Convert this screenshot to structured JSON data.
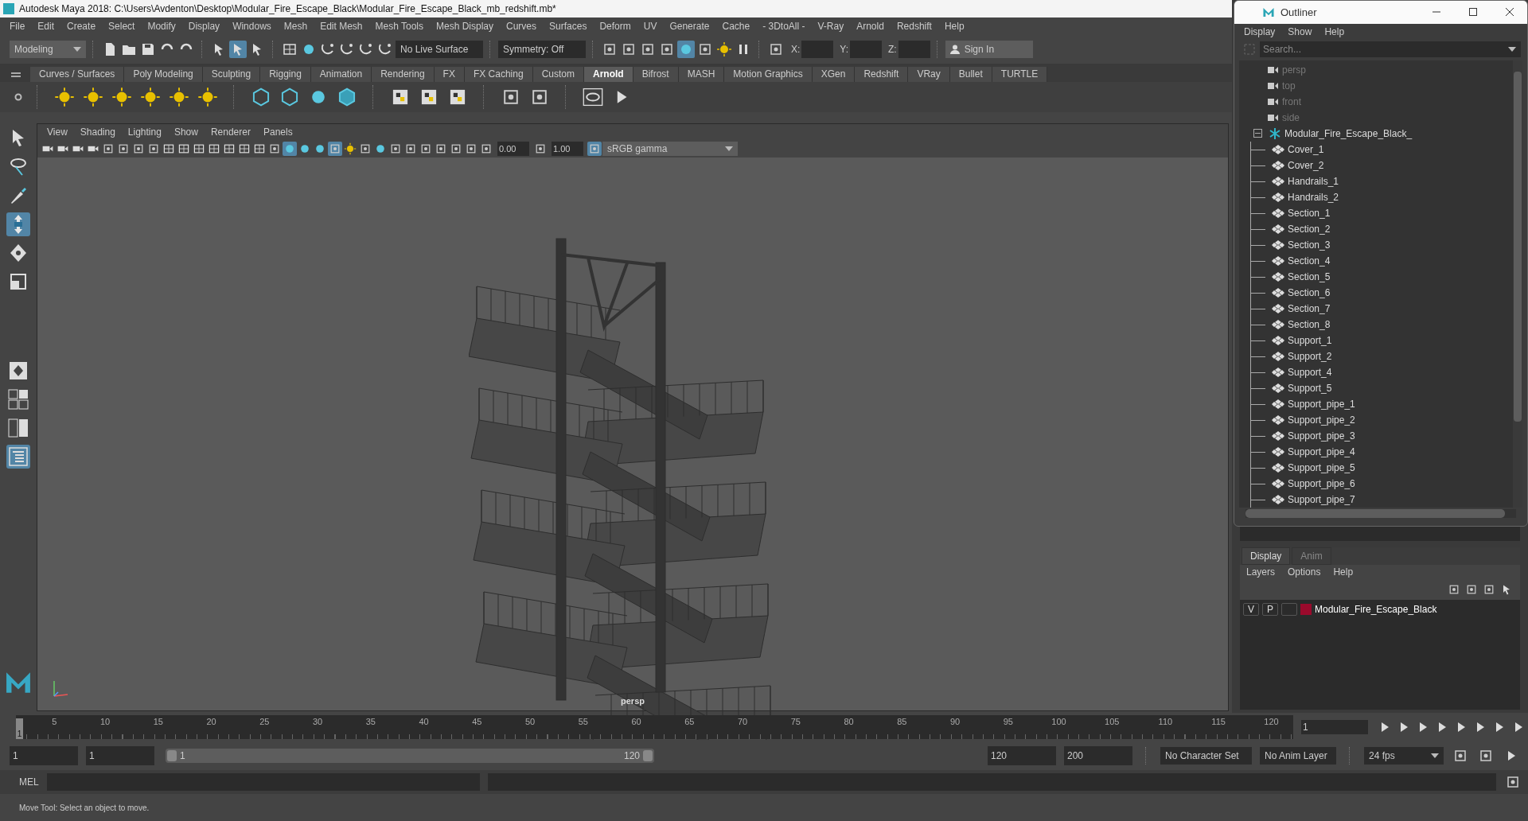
{
  "window": {
    "title": "Autodesk Maya 2018: C:\\Users\\Avdenton\\Desktop\\Modular_Fire_Escape_Black\\Modular_Fire_Escape_Black_mb_redshift.mb*"
  },
  "menu_bar": [
    "File",
    "Edit",
    "Create",
    "Select",
    "Modify",
    "Display",
    "Windows",
    "Mesh",
    "Edit Mesh",
    "Mesh Tools",
    "Mesh Display",
    "Curves",
    "Surfaces",
    "Deform",
    "UV",
    "Generate",
    "Cache",
    "- 3DtoAll -",
    "V-Ray",
    "Arnold",
    "Redshift",
    "Help"
  ],
  "status_line": {
    "mode": "Modeling",
    "live_surface": "No Live Surface",
    "symmetry": "Symmetry: Off",
    "x_label": "X:",
    "y_label": "Y:",
    "z_label": "Z:",
    "sign_in": "Sign In"
  },
  "shelf_tabs": [
    {
      "label": "Curves / Surfaces",
      "selected": false
    },
    {
      "label": "Poly Modeling",
      "selected": false
    },
    {
      "label": "Sculpting",
      "selected": false
    },
    {
      "label": "Rigging",
      "selected": false
    },
    {
      "label": "Animation",
      "selected": false
    },
    {
      "label": "Rendering",
      "selected": false
    },
    {
      "label": "FX",
      "selected": false
    },
    {
      "label": "FX Caching",
      "selected": false
    },
    {
      "label": "Custom",
      "selected": false
    },
    {
      "label": "Arnold",
      "selected": true
    },
    {
      "label": "Bifrost",
      "selected": false
    },
    {
      "label": "MASH",
      "selected": false
    },
    {
      "label": "Motion Graphics",
      "selected": false
    },
    {
      "label": "XGen",
      "selected": false
    },
    {
      "label": "Redshift",
      "selected": false
    },
    {
      "label": "VRay",
      "selected": false
    },
    {
      "label": "Bullet",
      "selected": false
    },
    {
      "label": "TURTLE",
      "selected": false
    }
  ],
  "toolbox": [
    {
      "kind": "select",
      "selected": false
    },
    {
      "kind": "lasso",
      "selected": false
    },
    {
      "kind": "paint",
      "selected": false
    },
    {
      "kind": "move",
      "selected": true
    },
    {
      "kind": "rotate",
      "selected": false
    },
    {
      "kind": "scale",
      "selected": false
    }
  ],
  "viewport": {
    "menus": [
      "View",
      "Shading",
      "Lighting",
      "Show",
      "Renderer",
      "Panels"
    ],
    "exposure": "0.00",
    "gamma": "1.00",
    "color_space": "sRGB gamma",
    "camera_label": "persp"
  },
  "outliner": {
    "title": "Outliner",
    "menus": [
      "Display",
      "Show",
      "Help"
    ],
    "search_placeholder": "Search...",
    "items": [
      {
        "kind": "camera",
        "label": "persp"
      },
      {
        "kind": "camera",
        "label": "top"
      },
      {
        "kind": "camera",
        "label": "front"
      },
      {
        "kind": "camera",
        "label": "side"
      },
      {
        "kind": "group",
        "label": "Modular_Fire_Escape_Black_",
        "expanded": true,
        "children": [
          {
            "kind": "mesh",
            "label": "Cover_1"
          },
          {
            "kind": "mesh",
            "label": "Cover_2"
          },
          {
            "kind": "mesh",
            "label": "Handrails_1"
          },
          {
            "kind": "mesh",
            "label": "Handrails_2"
          },
          {
            "kind": "mesh",
            "label": "Section_1"
          },
          {
            "kind": "mesh",
            "label": "Section_2"
          },
          {
            "kind": "mesh",
            "label": "Section_3"
          },
          {
            "kind": "mesh",
            "label": "Section_4"
          },
          {
            "kind": "mesh",
            "label": "Section_5"
          },
          {
            "kind": "mesh",
            "label": "Section_6"
          },
          {
            "kind": "mesh",
            "label": "Section_7"
          },
          {
            "kind": "mesh",
            "label": "Section_8"
          },
          {
            "kind": "mesh",
            "label": "Support_1"
          },
          {
            "kind": "mesh",
            "label": "Support_2"
          },
          {
            "kind": "mesh",
            "label": "Support_4"
          },
          {
            "kind": "mesh",
            "label": "Support_5"
          },
          {
            "kind": "mesh",
            "label": "Support_pipe_1"
          },
          {
            "kind": "mesh",
            "label": "Support_pipe_2"
          },
          {
            "kind": "mesh",
            "label": "Support_pipe_3"
          },
          {
            "kind": "mesh",
            "label": "Support_pipe_4"
          },
          {
            "kind": "mesh",
            "label": "Support_pipe_5"
          },
          {
            "kind": "mesh",
            "label": "Support_pipe_6"
          },
          {
            "kind": "mesh",
            "label": "Support_pipe_7"
          }
        ]
      }
    ]
  },
  "layer_editor": {
    "tabs": [
      {
        "label": "Display",
        "selected": true
      },
      {
        "label": "Anim",
        "selected": false
      }
    ],
    "menus": [
      "Layers",
      "Options",
      "Help"
    ],
    "layers": [
      {
        "visible_label": "V",
        "playback_label": "P",
        "color": "#9b0a2c",
        "name": "Modular_Fire_Escape_Black"
      }
    ]
  },
  "timeline": {
    "current_frame": "1",
    "level": 0,
    "ticks": [
      "5",
      "10",
      "15",
      "20",
      "25",
      "30",
      "35",
      "40",
      "45",
      "50",
      "55",
      "60",
      "65",
      "70",
      "75",
      "80",
      "85",
      "90",
      "95",
      "100",
      "105",
      "110",
      "115",
      "120"
    ],
    "current_frame_field": "1"
  },
  "range": {
    "level": 1,
    "start": "1",
    "playback_start": "1",
    "slider_start": "1",
    "slider_end": "120",
    "playback_end": "120",
    "end": "200",
    "character_set": "No Character Set",
    "anim_layer": "No Anim Layer",
    "fps": "24 fps"
  },
  "command_line": {
    "label": "MEL"
  },
  "status_bar": {
    "message": "Move Tool: Select an object to move."
  }
}
